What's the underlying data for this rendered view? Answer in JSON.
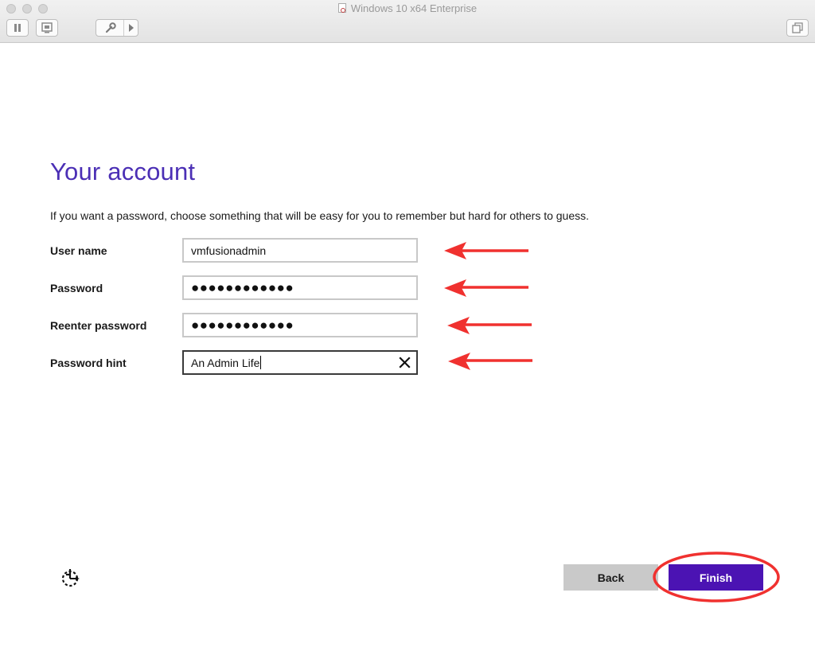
{
  "window": {
    "title": "Windows 10 x64 Enterprise",
    "toolbar": [
      "pause-icon",
      "snapshot-icon",
      "settings-wrench-icon",
      "chevron-right-icon",
      "restore-windows-icon"
    ]
  },
  "page": {
    "heading": "Your account",
    "description": "If you want a password, choose something that will be easy for you to remember but hard for others to guess."
  },
  "form": {
    "username": {
      "label": "User name",
      "value": "vmfusionadmin"
    },
    "password": {
      "label": "Password",
      "value": "●●●●●●●●●●●●"
    },
    "reenter": {
      "label": "Reenter password",
      "value": "●●●●●●●●●●●●"
    },
    "hint": {
      "label": "Password hint",
      "value": "An Admin Life"
    }
  },
  "buttons": {
    "back": "Back",
    "finish": "Finish"
  },
  "colors": {
    "heading": "#4b2fb5",
    "finish": "#4b13b3",
    "annotation": "#f0312f"
  }
}
